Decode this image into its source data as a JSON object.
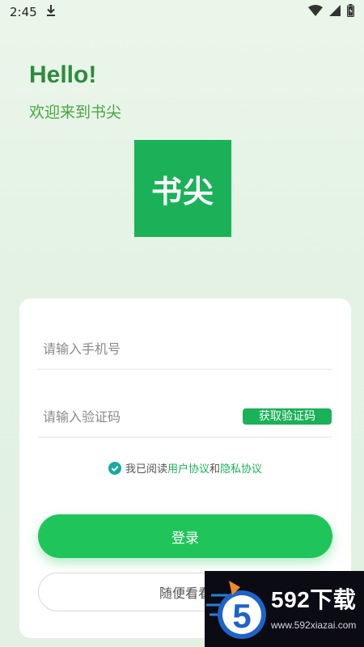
{
  "status_bar": {
    "time": "2:45",
    "icons": [
      "download-icon",
      "wifi-icon",
      "signal-icon",
      "battery-icon"
    ]
  },
  "header": {
    "greeting": "Hello!",
    "welcome": "欢迎来到书尖"
  },
  "logo": {
    "text": "书尖",
    "color": "#1bb158"
  },
  "form": {
    "phone_placeholder": "请输入手机号",
    "code_placeholder": "请输入验证码",
    "get_code_label": "获取验证码",
    "agreement": {
      "prefix": "我已阅读",
      "user_agreement": "用户协议",
      "and": "和",
      "privacy_agreement": "隐私协议",
      "checked": true
    },
    "login_label": "登录",
    "browse_label": "随便看看"
  },
  "watermark": {
    "title": "592下载",
    "url": "www.592xiazai.com"
  },
  "colors": {
    "accent": "#1bb158",
    "login_button": "#1fc55a",
    "heading": "#2f8a3d"
  }
}
